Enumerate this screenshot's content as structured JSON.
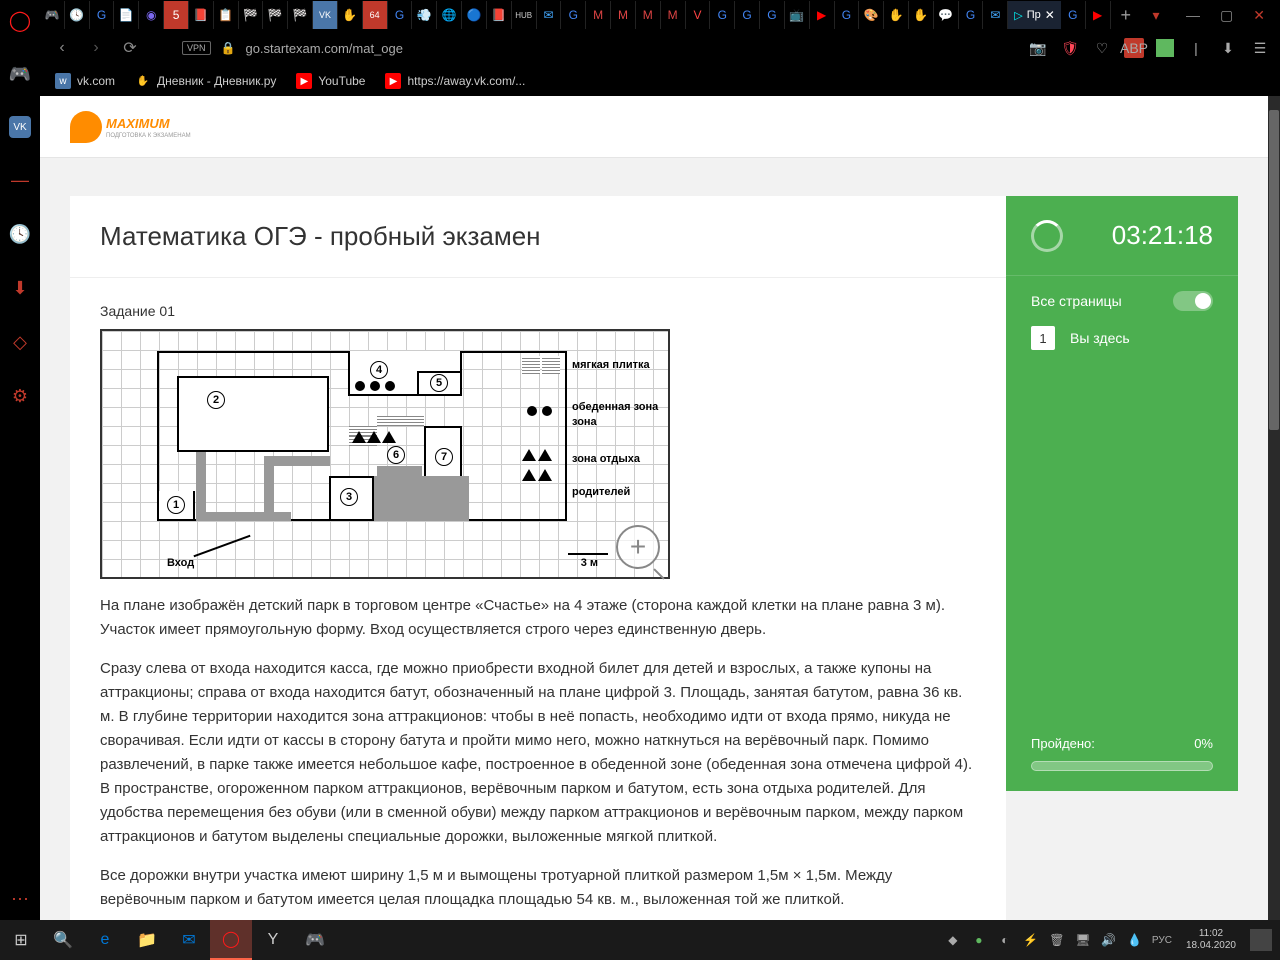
{
  "browser": {
    "url": "go.startexam.com/mat_oge",
    "vpn": "VPN",
    "active_tab": {
      "label": "Пр",
      "close": "✕"
    },
    "new_tab": "+"
  },
  "bookmarks": [
    {
      "label": "vk.com"
    },
    {
      "label": "Дневник - Дневник.ру"
    },
    {
      "label": "YouTube"
    },
    {
      "label": "https://away.vk.com/..."
    }
  ],
  "site": {
    "logo": "MAXIMUM",
    "logo_sub": "ПОДГОТОВКА К ЭКЗАМЕНАМ"
  },
  "exam": {
    "title": "Математика ОГЭ - пробный экзамен",
    "task_label": "Задание 01",
    "diagram": {
      "entry": "Вход",
      "scale": "3 м",
      "labels": {
        "1": "1",
        "2": "2",
        "3": "3",
        "4": "4",
        "5": "5",
        "6": "6",
        "7": "7"
      },
      "legend": {
        "soft": "мягкая плитка",
        "dining": "обеденная зона",
        "rest1": "зона отдыха",
        "rest2": "родителей"
      }
    },
    "paragraphs": [
      "На плане изображён детский парк в торговом центре «Счастье» на 4 этаже (сторона каждой клетки на плане равна 3 м). Участок имеет прямоугольную форму. Вход осуществляется строго через единственную дверь.",
      "Сразу слева от входа находится касса, где можно приобрести входной билет для детей и взрослых, а также купоны на аттракционы; справа от входа находится батут, обозначенный на плане цифрой 3. Площадь, занятая батутом, равна 36 кв. м. В глубине территории находится зона аттракционов: чтобы в неё попасть, необходимо идти от входа прямо, никуда не сворачивая. Если идти от кассы в сторону батута и пройти мимо него, можно наткнуться на верёвочный парк. Помимо развлечений, в парке также имеется небольшое кафе, построенное в обеденной зоне (обеденная зона отмечена цифрой 4). В пространстве, огороженном парком аттракционов, верёвочным парком и батутом, есть зона отдыха родителей. Для удобства перемещения без обуви (или в сменной обуви) между парком аттракционов и верёвочным парком, между парком аттракционов и батутом выделены специальные дорожки, выложенные мягкой плиткой.",
      "Все дорожки внутри участка имеют ширину 1,5 м и вымощены тротуарной плиткой размером 1,5м × 1,5м.  Между верёвочным парком и батутом имеется целая площадка площадью 54 кв. м., выложенная той же плиткой."
    ]
  },
  "sidebar": {
    "timer": "03:21:18",
    "all_pages": "Все страницы",
    "pages": [
      {
        "num": "1",
        "label": "Вы здесь"
      }
    ],
    "progress_label": "Пройдено:",
    "progress_value": "0%"
  },
  "systray": {
    "lang": "РУС",
    "time": "11:02",
    "date": "18.04.2020"
  }
}
